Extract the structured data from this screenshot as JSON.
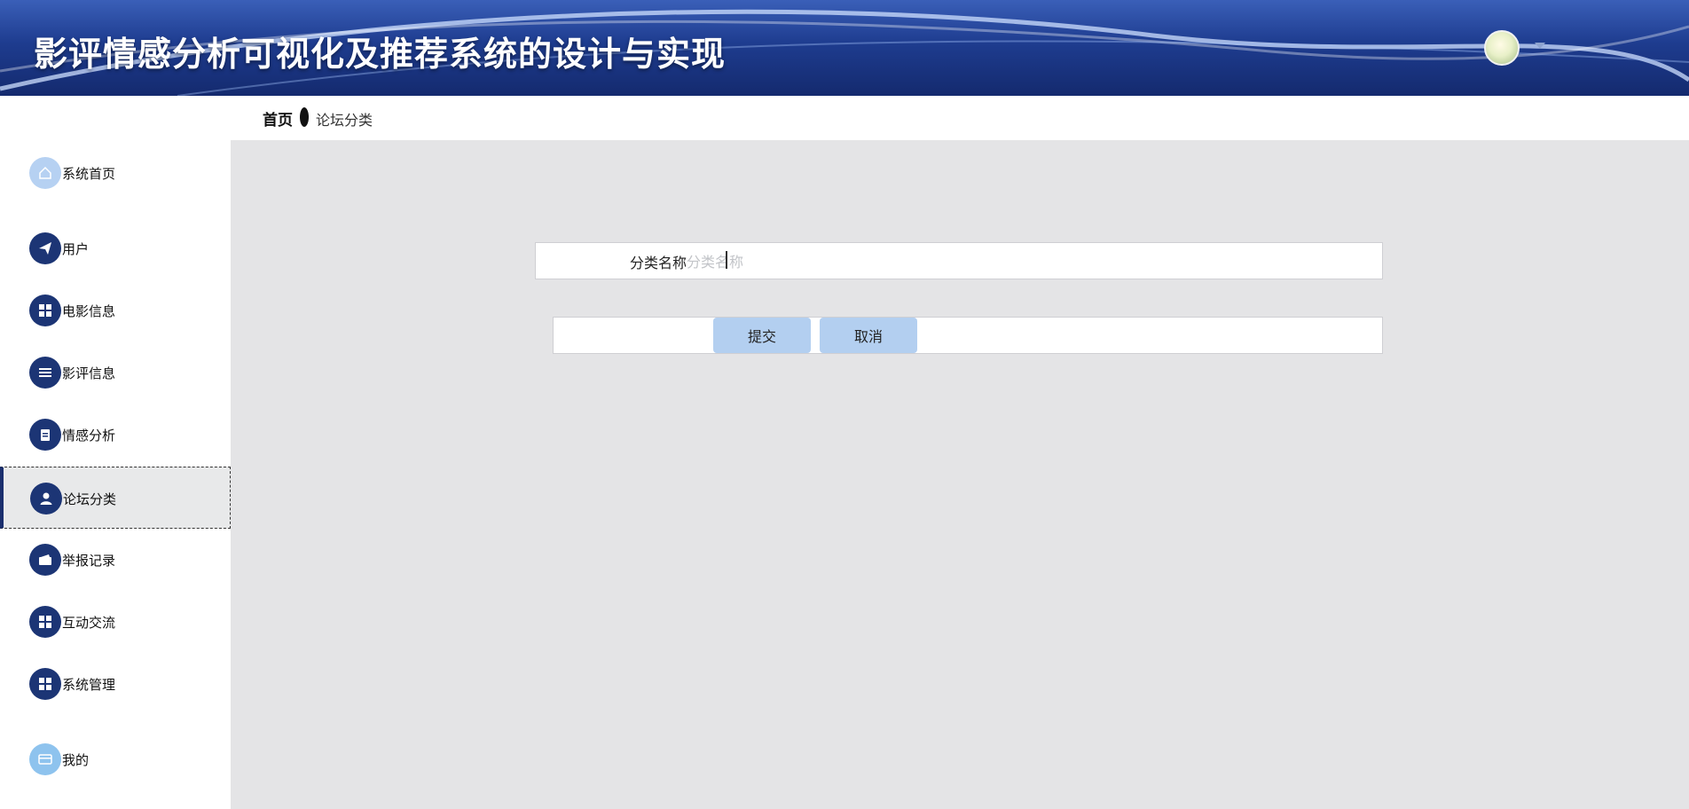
{
  "header": {
    "title": "影评情感分析可视化及推荐系统的设计与实现",
    "avatar_icon": "user-avatar",
    "caret_icon": "caret-down-icon"
  },
  "breadcrumb": {
    "home": "首页",
    "current": "论坛分类"
  },
  "sidebar": {
    "items": [
      {
        "label": "系统首页",
        "icon": "home-icon"
      },
      {
        "label": "用户",
        "icon": "paper-plane-icon"
      },
      {
        "label": "电影信息",
        "icon": "grid-icon"
      },
      {
        "label": "影评信息",
        "icon": "list-icon"
      },
      {
        "label": "情感分析",
        "icon": "clipboard-icon"
      },
      {
        "label": "论坛分类",
        "icon": "user-icon"
      },
      {
        "label": "举报记录",
        "icon": "wallet-icon"
      },
      {
        "label": "互动交流",
        "icon": "grid-icon"
      },
      {
        "label": "系统管理",
        "icon": "grid-icon"
      },
      {
        "label": "我的",
        "icon": "card-icon"
      }
    ],
    "active": "论坛分类"
  },
  "form": {
    "category_label": "分类名称",
    "category_value": "",
    "category_placeholder": "分类名称",
    "submit_label": "提交",
    "cancel_label": "取消"
  },
  "colors": {
    "header_dark": "#142a6e",
    "icon_bg": "#1c3575",
    "button_bg": "#b3cff0",
    "content_bg": "#e4e4e6"
  }
}
